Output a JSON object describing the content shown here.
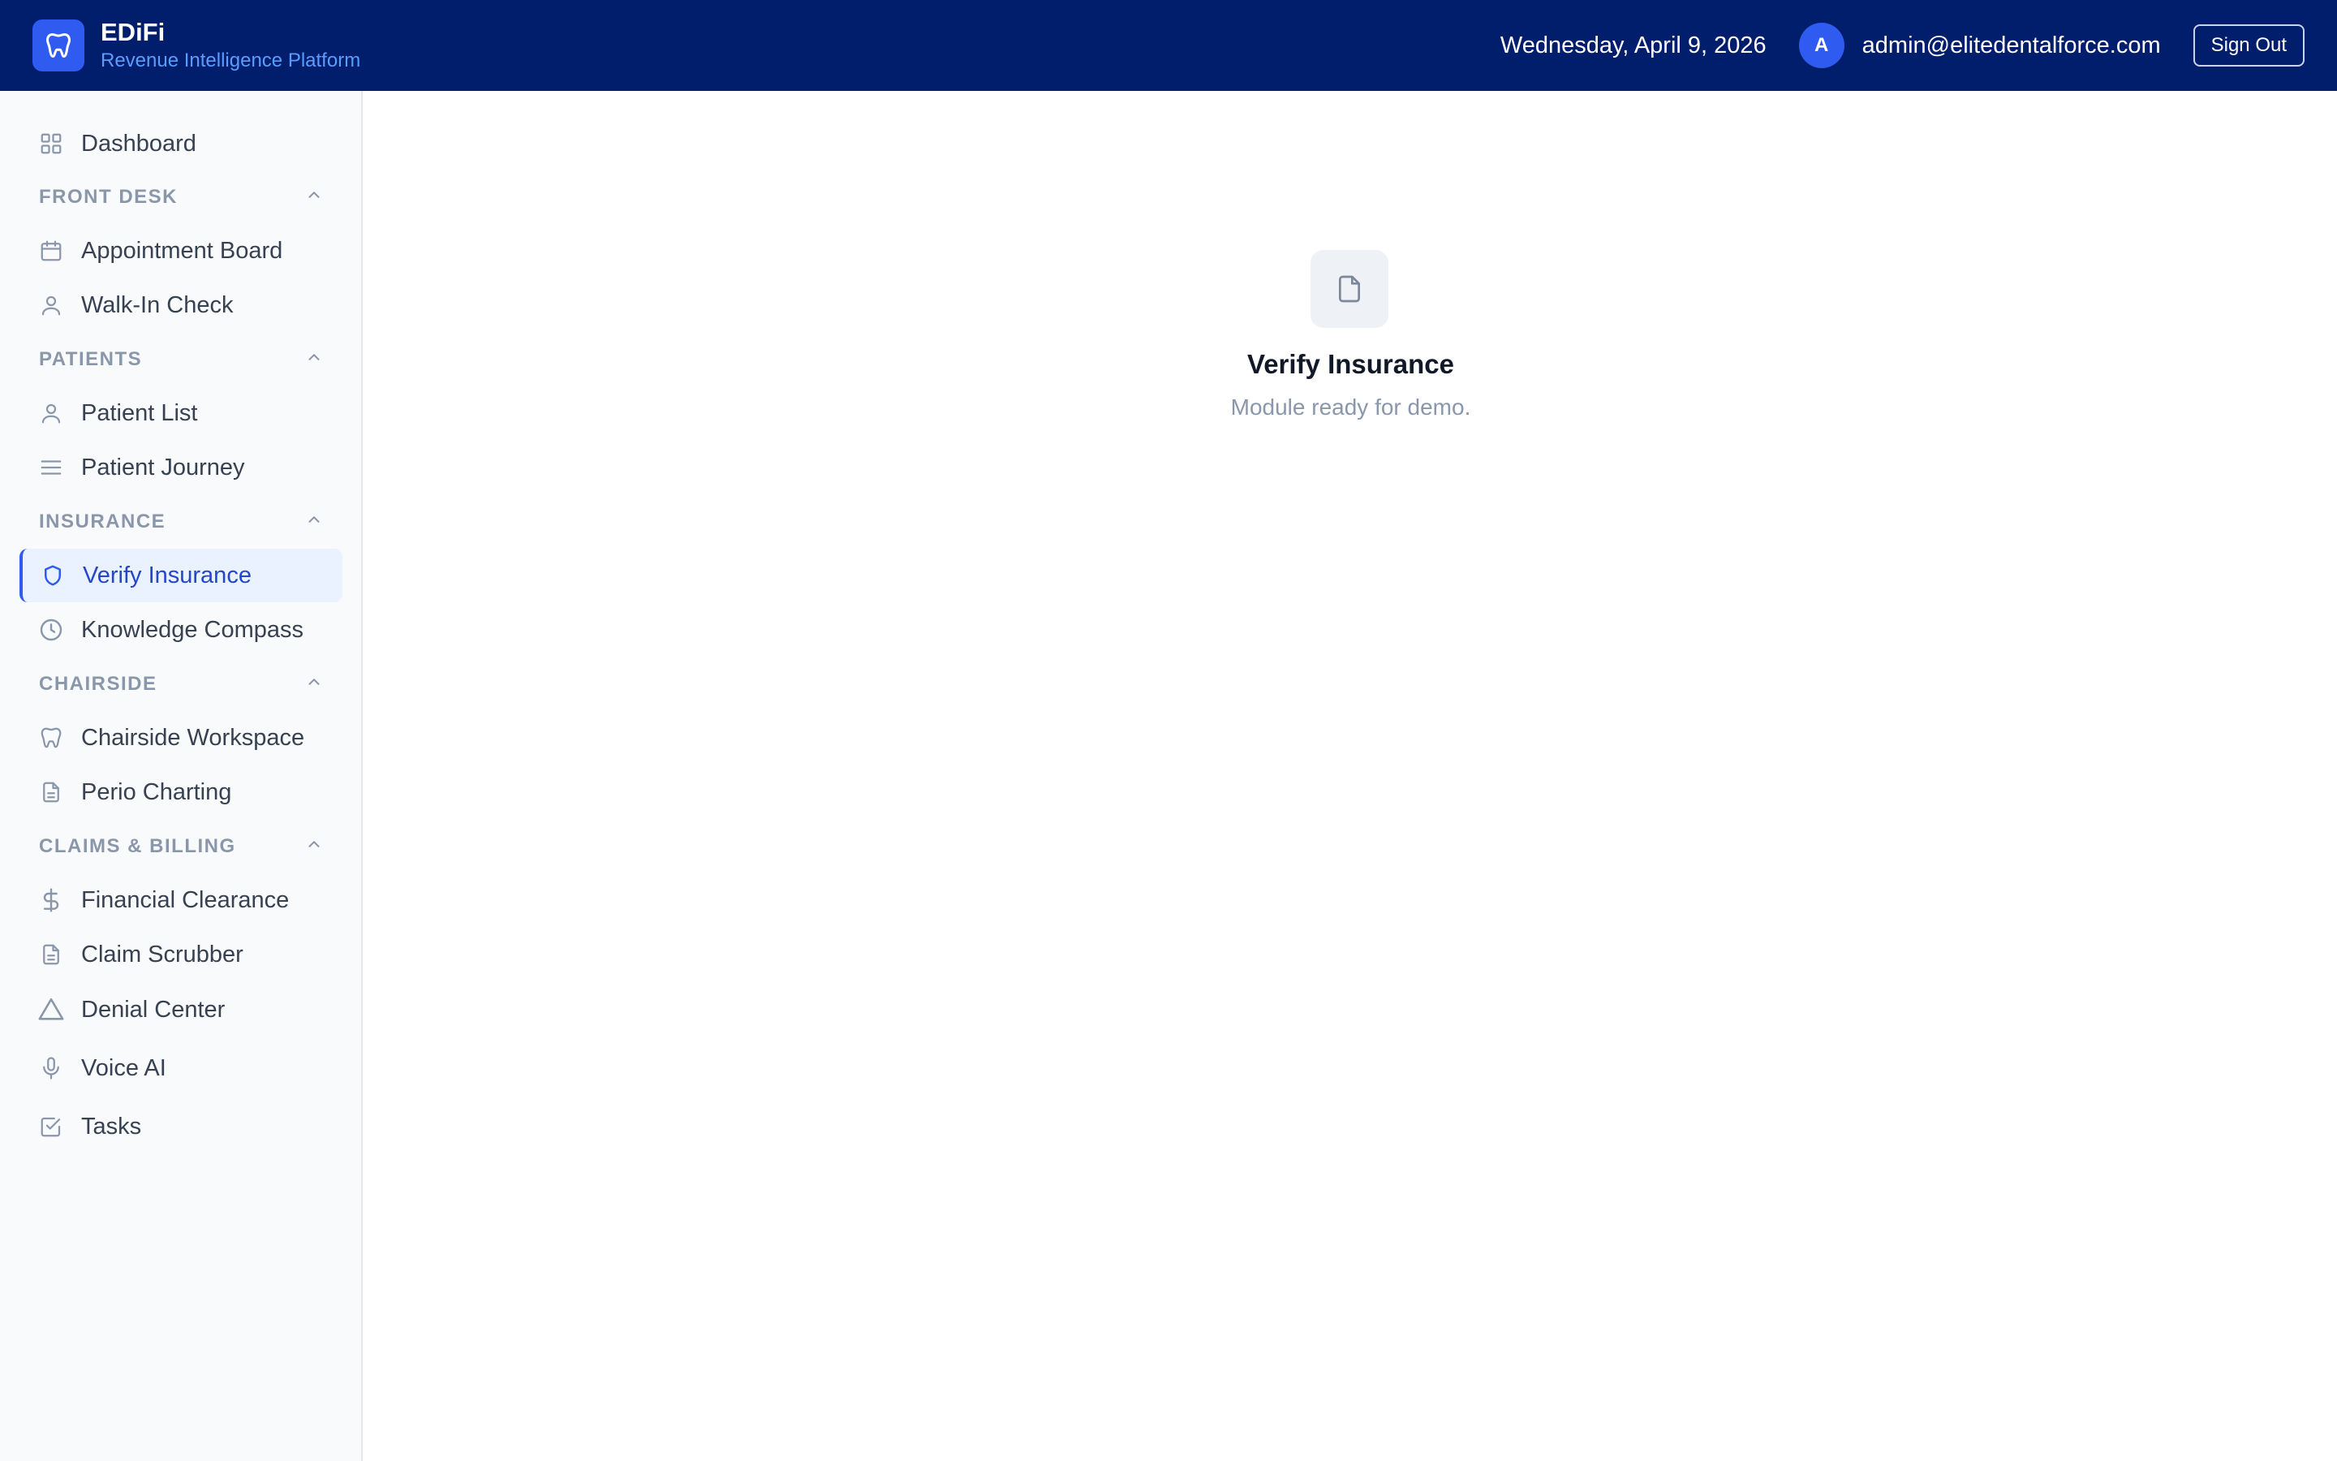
{
  "header": {
    "brand_name": "EDiFi",
    "brand_subtitle": "Revenue Intelligence Platform",
    "date": "Wednesday, April 9, 2026",
    "avatar_initial": "A",
    "user_email": "admin@elitedentalforce.com",
    "sign_out_label": "Sign Out"
  },
  "sidebar": {
    "dashboard": "Dashboard",
    "sections": {
      "front_desk": "FRONT DESK",
      "patients": "PATIENTS",
      "insurance": "INSURANCE",
      "chairside": "CHAIRSIDE",
      "claims_billing": "CLAIMS & BILLING"
    },
    "items": {
      "appointment_board": "Appointment Board",
      "walk_in_check": "Walk-In Check",
      "patient_list": "Patient List",
      "patient_journey": "Patient Journey",
      "verify_insurance": "Verify Insurance",
      "knowledge_compass": "Knowledge Compass",
      "chairside_workspace": "Chairside Workspace",
      "perio_charting": "Perio Charting",
      "financial_clearance": "Financial Clearance",
      "claim_scrubber": "Claim Scrubber",
      "denial_center": "Denial Center",
      "voice_ai": "Voice AI",
      "tasks": "Tasks"
    },
    "active_item": "Verify Insurance"
  },
  "main": {
    "title": "Verify Insurance",
    "subtitle": "Module ready for demo."
  },
  "colors": {
    "header_bg": "#001e6c",
    "accent": "#2f5bf0",
    "active_bg": "#eaf1ff",
    "active_text": "#2446c7",
    "sidebar_bg": "#f8fafc",
    "section_text": "#8a97ab"
  },
  "icons": {
    "brand": "tooth-icon",
    "dashboard": "grid-icon",
    "appointment_board": "calendar-icon",
    "walk_in_check": "user-icon",
    "patient_list": "user-icon",
    "patient_journey": "menu-lines-icon",
    "verify_insurance": "shield-icon",
    "knowledge_compass": "clock-icon",
    "chairside_workspace": "tooth-icon",
    "perio_charting": "document-icon",
    "financial_clearance": "dollar-icon",
    "claim_scrubber": "document-icon",
    "denial_center": "warning-triangle-icon",
    "voice_ai": "microphone-icon",
    "tasks": "checkbox-icon",
    "empty_state": "file-icon",
    "section_toggle": "chevron-up-icon"
  }
}
